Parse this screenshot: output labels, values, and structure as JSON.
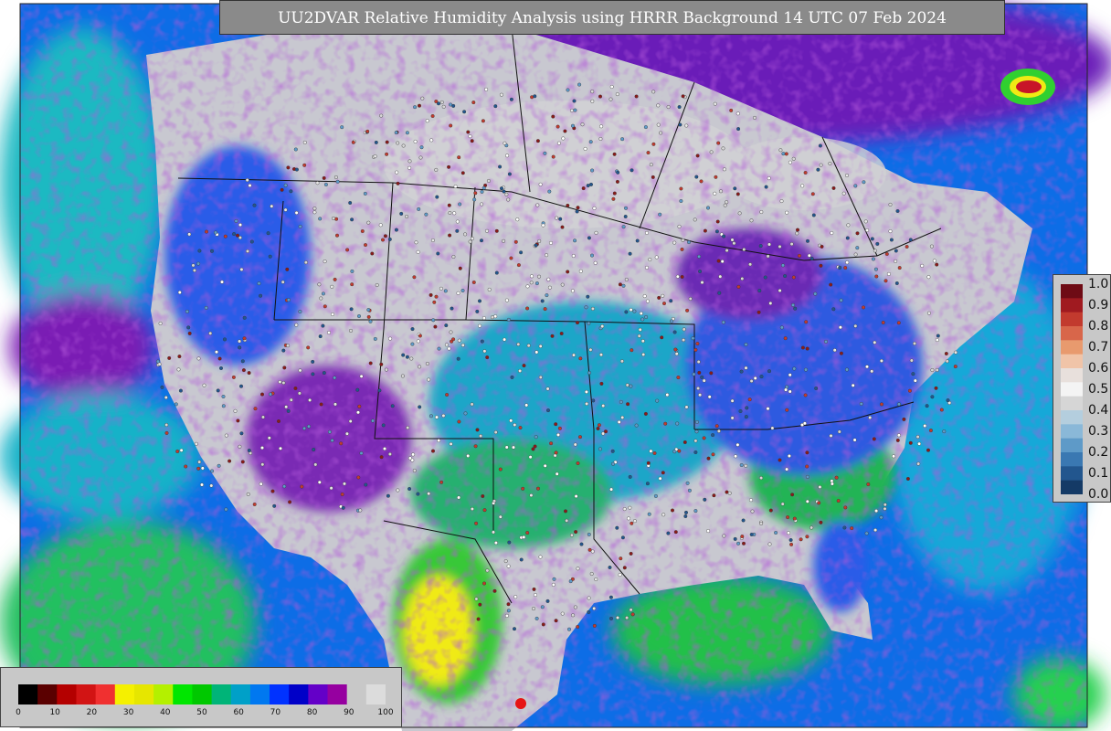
{
  "title": "UU2DVAR Relative Humidity Analysis using HRRR Background 14 UTC 07 Feb 2024",
  "colorbar_right": {
    "ticks": [
      "1.0",
      "0.9",
      "0.8",
      "0.7",
      "0.6",
      "0.5",
      "0.4",
      "0.3",
      "0.2",
      "0.1",
      "0.0"
    ],
    "colors": [
      "#6e0b15",
      "#a01a20",
      "#c23a2e",
      "#d8664a",
      "#e89a6e",
      "#f0c4a8",
      "#e8e0dc",
      "#f4f4f4",
      "#d6d6d6",
      "#b4cede",
      "#8ab8d8",
      "#5e9ac8",
      "#3a78b2",
      "#22568e",
      "#143a66"
    ]
  },
  "colorbar_bottom": {
    "ticks": [
      "0",
      "10",
      "20",
      "30",
      "40",
      "50",
      "60",
      "70",
      "80",
      "90",
      "100"
    ],
    "colors": [
      "#000000",
      "#5a0000",
      "#b40000",
      "#d21414",
      "#f03030",
      "#f5f000",
      "#e6e600",
      "#b4f000",
      "#00e600",
      "#00c800",
      "#00b478",
      "#00a0c8",
      "#0078f0",
      "#0032ff",
      "#0000c8",
      "#6400c8",
      "#9600a0",
      "#c8c8c8",
      "#dcdcdc"
    ]
  },
  "palette": {
    "ocean_teal": "#19b4c8",
    "ocean_blue": "#0a64e6",
    "land_gray": "#c9c9cf",
    "humid_purple": "#7a1fb4",
    "dry_yellow": "#f0ea14",
    "green": "#14c832",
    "red_spot": "#e61414"
  }
}
